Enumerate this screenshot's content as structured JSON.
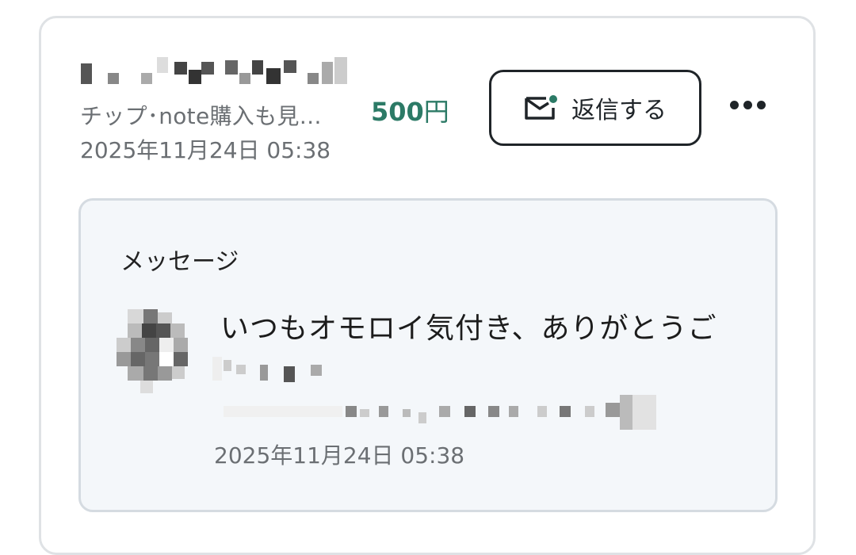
{
  "tip": {
    "source_text": "チップ･note購入も見…",
    "amount_number": "500",
    "amount_unit": "円",
    "date": "2025年11月24日 05:38",
    "reply_button_label": "返信する",
    "more_icon": "more-horizontal-icon",
    "mail_icon": "mail-icon"
  },
  "message": {
    "heading": "メッセージ",
    "text": "いつもオモロイ気付き、ありがとうご",
    "date": "2025年11月24日 05:38"
  },
  "colors": {
    "accent_green": "#2c7a66",
    "text_gray": "#6b6f73",
    "border": "#dfe2e5",
    "message_bg": "#f4f7fa"
  }
}
